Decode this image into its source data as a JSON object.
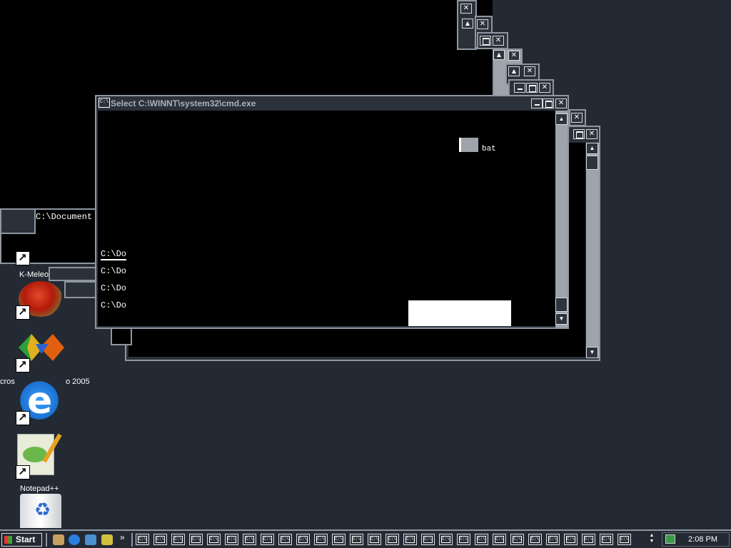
{
  "cmd_window": {
    "title": "Select C:\\WINNT\\system32\\cmd.exe",
    "icon_text": "C:\\",
    "lines": [
      "C:\\Do",
      "C:\\Do",
      "C:\\Do",
      "C:\\Do"
    ],
    "fragment_text": "bat"
  },
  "background_window": {
    "text": "C:\\Document"
  },
  "desktop_icons": [
    {
      "name": "kmeleon",
      "label": "K-Meleo"
    },
    {
      "name": "visual-studio",
      "label": "cros",
      "label2": "o 2005"
    },
    {
      "name": "internet-explorer",
      "label": ""
    },
    {
      "name": "notepad-plus-plus",
      "label": "Notepad++"
    },
    {
      "name": "recycle-bin",
      "label": ""
    }
  ],
  "taskbar": {
    "start_label": "Start",
    "quick_launch": [
      "show-desktop-icon",
      "ie-icon",
      "outlook-icon",
      "search-icon"
    ],
    "chevron": "»",
    "items_count_label": "C:\\",
    "clock": "2:08 PM"
  },
  "colors": {
    "desktop": "#232a33",
    "window_frame": "#8e969f",
    "console_bg": "#000000"
  }
}
